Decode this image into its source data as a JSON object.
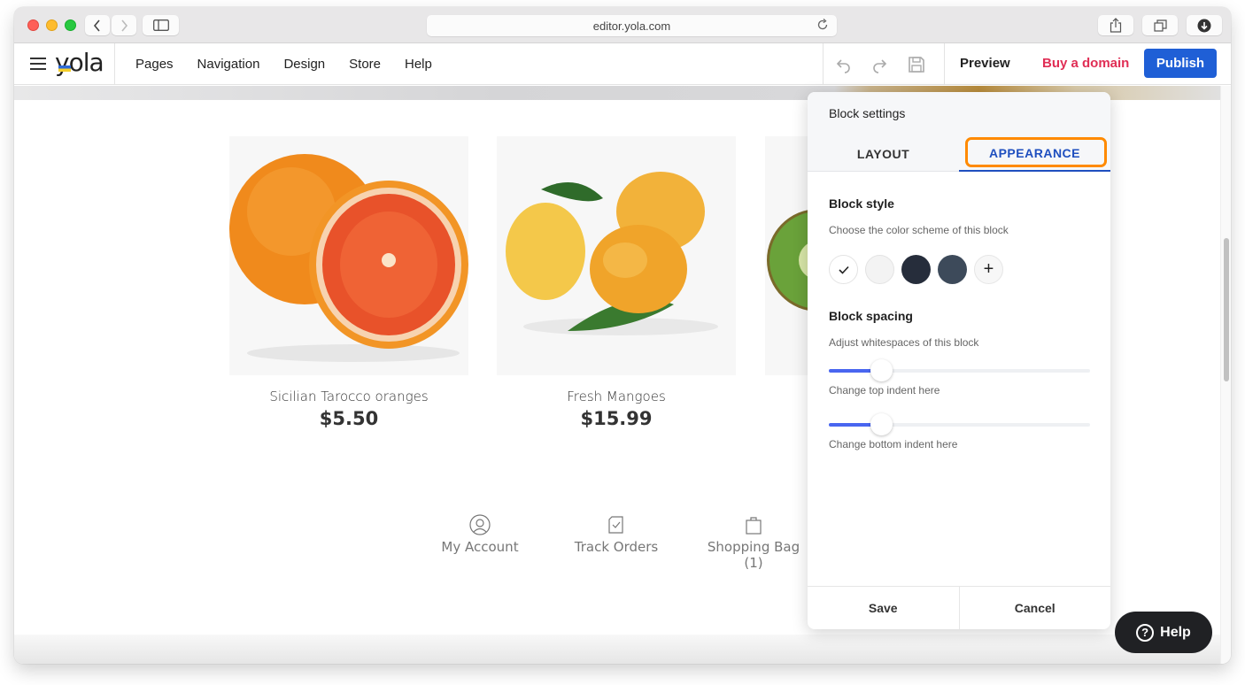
{
  "browser": {
    "url": "editor.yola.com"
  },
  "app": {
    "logo": "yola",
    "nav": [
      "Pages",
      "Navigation",
      "Design",
      "Store",
      "Help"
    ],
    "preview_label": "Preview",
    "buy_domain_label": "Buy a domain",
    "publish_label": "Publish"
  },
  "products": [
    {
      "name": "Sicilian Tarocco oranges",
      "price": "$5.50"
    },
    {
      "name": "Fresh Mangoes",
      "price": "$15.99"
    }
  ],
  "shop_links": [
    {
      "label": "My Account",
      "icon": "user-icon"
    },
    {
      "label": "Track Orders",
      "icon": "orders-icon"
    },
    {
      "label": "Shopping Bag (1)",
      "icon": "bag-icon"
    }
  ],
  "panel": {
    "title": "Block settings",
    "tabs": [
      "LAYOUT",
      "APPEARANCE"
    ],
    "active_tab": "APPEARANCE",
    "block_style": {
      "title": "Block style",
      "desc": "Choose the color scheme of this block",
      "swatches": [
        "#ffffff",
        "#f3f3f3",
        "#262d3b",
        "#3d4a5a"
      ],
      "selected_index": 0,
      "add_label": "+"
    },
    "block_spacing": {
      "title": "Block spacing",
      "desc": "Adjust whitespaces of this block",
      "top_label": "Change top indent here",
      "bottom_label": "Change bottom indent here",
      "top_value_pct": 20,
      "bottom_value_pct": 20
    },
    "save_label": "Save",
    "cancel_label": "Cancel"
  },
  "help_label": "Help",
  "colors": {
    "accent": "#1f5fd6",
    "buy_domain": "#e02e55",
    "highlight": "#ff8a00",
    "slider": "#4966f0"
  }
}
